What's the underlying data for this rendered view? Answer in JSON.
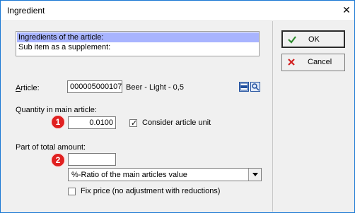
{
  "window": {
    "title": "Ingredient",
    "close_glyph": "✕"
  },
  "list": {
    "items": [
      {
        "label": "Ingredients of the article:",
        "selected": true
      },
      {
        "label": "Sub item as a supplement:",
        "selected": false
      }
    ]
  },
  "article": {
    "label": "Article:",
    "code": "000005000107",
    "description": "Beer - Light - 0,5"
  },
  "quantity": {
    "label": "Quantity in main article:",
    "badge": "1",
    "value": "0.0100",
    "consider_unit_label": "Consider article unit",
    "consider_unit_checked": true
  },
  "part": {
    "label": "Part of total amount:",
    "badge": "2",
    "value": "",
    "ratio_selected": "%-Ratio of the main articles value",
    "fix_price_label": "Fix price (no adjustment with reductions)",
    "fix_price_checked": false
  },
  "buttons": {
    "ok": {
      "label": "OK",
      "accent": "#2e8b2e"
    },
    "cancel": {
      "label": "Cancel",
      "accent": "#d11f1f"
    }
  },
  "colors": {
    "selection": "#a8b4ff",
    "badge": "#e02020",
    "title_border": "#1a78d4"
  },
  "icons": {
    "close": "close-icon",
    "window_icon": "window-icon",
    "search": "search-icon",
    "dropdown": "chevron-down-icon",
    "ok": "check-icon",
    "cancel": "x-icon"
  }
}
